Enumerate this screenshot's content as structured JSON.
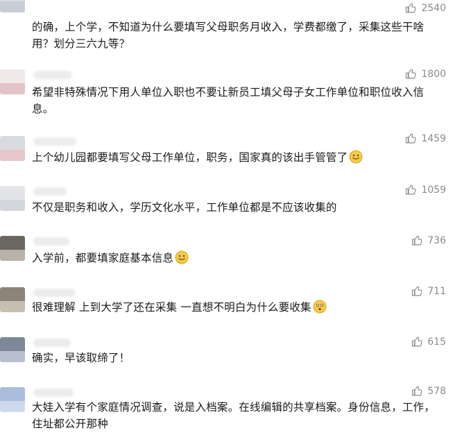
{
  "colors": {
    "text": "#1a1a1a",
    "likes": "#8a8a8a",
    "background": "#ffffff"
  },
  "like_icon": "thumbs-up-icon",
  "comments": [
    {
      "likes": "2540",
      "text": "的确，上个学，不知道为什么要填写父母职务月收入，学费都缴了，采集这些干啥用？划分三六九等？",
      "emoji": ""
    },
    {
      "likes": "1800",
      "text": "希望非特殊情况下用人单位入职也不要让新员工填父母子女工作单位和职位收入信息。",
      "emoji": ""
    },
    {
      "likes": "1459",
      "text": "上个幼儿园都要填写父母工作单位，职务，国家真的该出手管管了",
      "emoji": "smile-emoji-icon"
    },
    {
      "likes": "1059",
      "text": "不仅是职务和收入，学历文化水平，工作单位都是不应该收集的",
      "emoji": ""
    },
    {
      "likes": "736",
      "text": "入学前，都要填家庭基本信息",
      "emoji": "smile-emoji-icon"
    },
    {
      "likes": "711",
      "text": "很难理解 上到大学了还在采集 一直想不明白为什么要收集",
      "emoji": "puzzled-emoji-icon"
    },
    {
      "likes": "615",
      "text": "确实，早该取缔了！",
      "emoji": ""
    },
    {
      "likes": "578",
      "text": "大娃入学有个家庭情况调查，说是入档案。在线编辑的共享档案。身份信息，工作，住址都公开那种",
      "emoji": ""
    }
  ]
}
